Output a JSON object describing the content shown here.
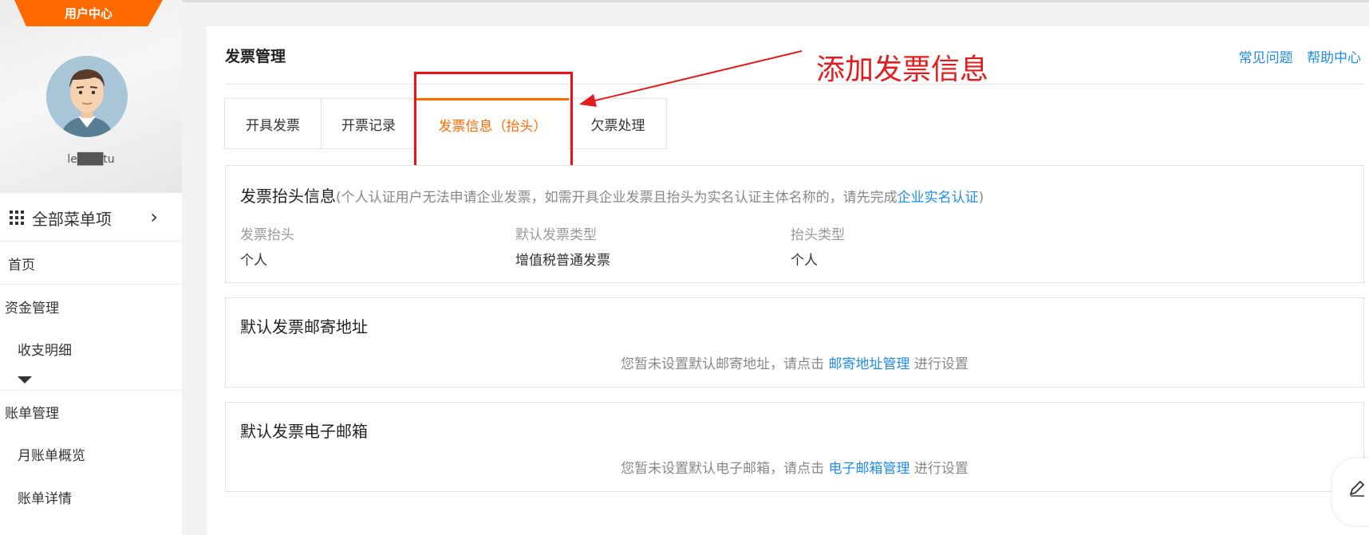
{
  "sidebar": {
    "user_center": "用户中心",
    "username": "le███tu",
    "menu_all": "全部菜单项",
    "items": [
      {
        "label": "首页"
      },
      {
        "label": "资金管理"
      },
      {
        "label": "收支明细"
      },
      {
        "label": "账单管理"
      },
      {
        "label": "月账单概览"
      },
      {
        "label": "账单详情"
      }
    ]
  },
  "header": {
    "title": "发票管理",
    "links": [
      "常见问题",
      "帮助中心"
    ]
  },
  "tabs": [
    {
      "label": "开具发票",
      "active": false
    },
    {
      "label": "开票记录",
      "active": false
    },
    {
      "label": "发票信息（抬头）",
      "active": true
    },
    {
      "label": "欠票处理",
      "active": false
    }
  ],
  "annotation": {
    "text": "添加发票信息",
    "color": "#e51c1c"
  },
  "invoice_header": {
    "title": "发票抬头信息",
    "note_prefix": "(个人认证用户无法申请企业发票，如需开具企业发票且抬头为实名认证主体名称的，请先完成",
    "note_link": "企业实名认证",
    "note_suffix": ")",
    "fields": [
      {
        "label": "发票抬头",
        "value": "个人"
      },
      {
        "label": "默认发票类型",
        "value": "增值税普通发票"
      },
      {
        "label": "抬头类型",
        "value": "个人"
      }
    ]
  },
  "mail_address": {
    "title": "默认发票邮寄地址",
    "msg_prefix": "您暂未设置默认邮寄地址，请点击",
    "msg_link": "邮寄地址管理",
    "msg_suffix": "进行设置"
  },
  "email": {
    "title": "默认发票电子邮箱",
    "msg_prefix": "您暂未设置默认电子邮箱，请点击",
    "msg_link": "电子邮箱管理",
    "msg_suffix": "进行设置"
  },
  "colors": {
    "accent": "#ff6a00",
    "link": "#1f8ceb",
    "annotation": "#e51c1c"
  },
  "icons": [
    "grid-icon",
    "chevron-right-icon",
    "caret-down-icon",
    "edit-icon",
    "avatar"
  ]
}
